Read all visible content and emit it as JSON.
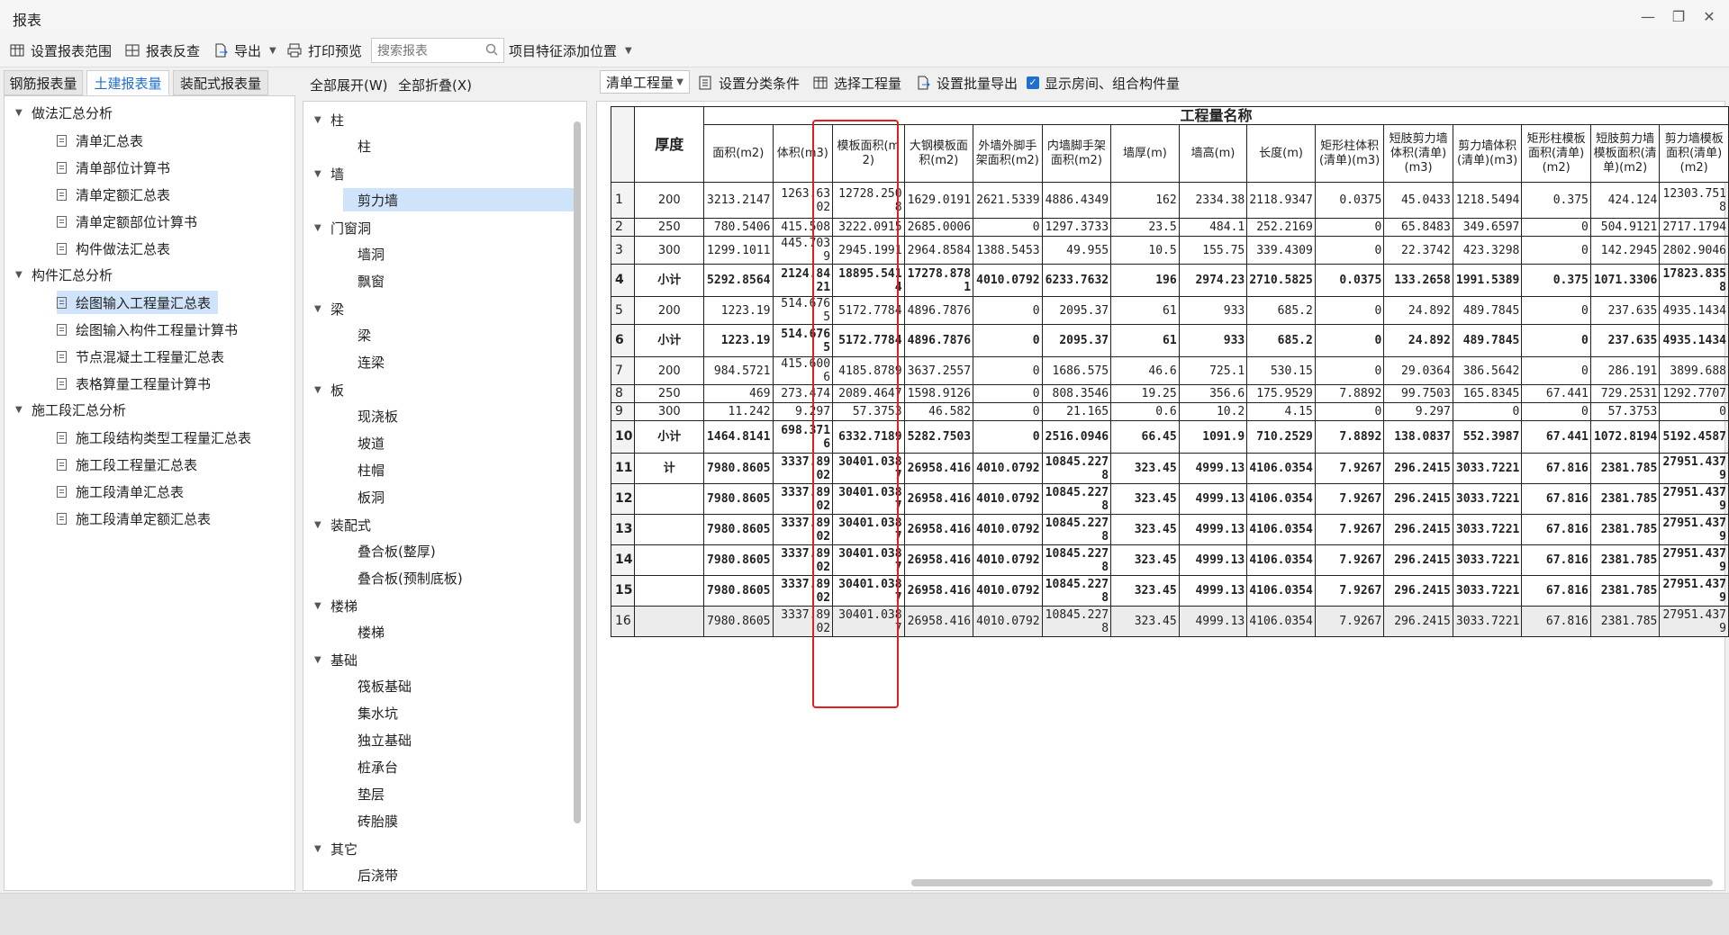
{
  "window": {
    "title": "报表"
  },
  "toolbar": {
    "set_range": "设置报表范围",
    "reverse_check": "报表反查",
    "export": "导出",
    "print_preview": "打印预览",
    "search_placeholder": "搜索报表",
    "add_feature_position": "项目特征添加位置"
  },
  "left_tabs": [
    {
      "label": "钢筋报表量",
      "active": false
    },
    {
      "label": "土建报表量",
      "active": true
    },
    {
      "label": "装配式报表量",
      "active": false
    }
  ],
  "left_tree": {
    "groups": [
      {
        "label": "做法汇总分析",
        "items": [
          "清单汇总表",
          "清单部位计算书",
          "清单定额汇总表",
          "清单定额部位计算书",
          "构件做法汇总表"
        ]
      },
      {
        "label": "构件汇总分析",
        "items": [
          "绘图输入工程量汇总表",
          "绘图输入构件工程量计算书",
          "节点混凝土工程量汇总表",
          "表格算量工程量计算书"
        ]
      },
      {
        "label": "施工段汇总分析",
        "items": [
          "施工段结构类型工程量汇总表",
          "施工段工程量汇总表",
          "施工段清单汇总表",
          "施工段清单定额汇总表"
        ]
      }
    ],
    "selected": "绘图输入工程量汇总表"
  },
  "middle": {
    "expand_all": "全部展开(W)",
    "collapse_all": "全部折叠(X)",
    "groups": [
      {
        "label": "柱",
        "items": [
          "柱"
        ]
      },
      {
        "label": "墙",
        "items": [
          "剪力墙"
        ]
      },
      {
        "label": "门窗洞",
        "items": [
          "墙洞",
          "飘窗"
        ]
      },
      {
        "label": "梁",
        "items": [
          "梁",
          "连梁"
        ]
      },
      {
        "label": "板",
        "items": [
          "现浇板",
          "坡道",
          "柱帽",
          "板洞"
        ]
      },
      {
        "label": "装配式",
        "items": [
          "叠合板(整厚)",
          "叠合板(预制底板)"
        ]
      },
      {
        "label": "楼梯",
        "items": [
          "楼梯"
        ]
      },
      {
        "label": "基础",
        "items": [
          "筏板基础",
          "集水坑",
          "独立基础",
          "桩承台",
          "垫层",
          "砖胎膜"
        ]
      },
      {
        "label": "其它",
        "items": [
          "后浇带"
        ]
      }
    ],
    "selected": "剪力墙"
  },
  "right_toolbar": {
    "quantity_select": "清单工程量",
    "set_category": "设置分类条件",
    "select_quantity": "选择工程量",
    "set_batch_export": "设置批量导出",
    "show_rooms": "显示房间、组合构件量",
    "show_rooms_checked": true
  },
  "report": {
    "group_header": "工程量名称",
    "thickness_header": "厚度",
    "columns": [
      "面积(m2)",
      "体积(m3)",
      "模板面积(m2)",
      "大钢模板面积(m2)",
      "外墙外脚手架面积(m2)",
      "内墙脚手架面积(m2)",
      "墙厚(m)",
      "墙高(m)",
      "长度(m)",
      "矩形柱体积(清单)(m3)",
      "短肢剪力墙体积(清单)(m3)",
      "剪力墙体积(清单)(m3)",
      "矩形柱模板面积(清单)(m2)",
      "短肢剪力墙模板面积(清单)(m2)",
      "剪力墙模板面积(清单)(m2)"
    ],
    "rows": [
      {
        "n": "1",
        "label": "200",
        "bold": false,
        "v": [
          "3213.2147",
          "1263.6302",
          "12728.2508",
          "1629.0191",
          "2621.5339",
          "4886.4349",
          "162",
          "2334.38",
          "2118.9347",
          "0.0375",
          "45.0433",
          "1218.5494",
          "0.375",
          "424.124",
          "12303.7518"
        ]
      },
      {
        "n": "2",
        "label": "250",
        "bold": false,
        "v": [
          "780.5406",
          "415.508",
          "3222.0915",
          "2685.0006",
          "0",
          "1297.3733",
          "23.5",
          "484.1",
          "252.2169",
          "0",
          "65.8483",
          "349.6597",
          "0",
          "504.9121",
          "2717.1794"
        ]
      },
      {
        "n": "3",
        "label": "300",
        "bold": false,
        "v": [
          "1299.1011",
          "445.7039",
          "2945.1991",
          "2964.8584",
          "1388.5453",
          "49.955",
          "10.5",
          "155.75",
          "339.4309",
          "0",
          "22.3742",
          "423.3298",
          "0",
          "142.2945",
          "2802.9046"
        ]
      },
      {
        "n": "4",
        "label": "小计",
        "bold": true,
        "v": [
          "5292.8564",
          "2124.8421",
          "18895.5414",
          "17278.8781",
          "4010.0792",
          "6233.7632",
          "196",
          "2974.23",
          "2710.5825",
          "0.0375",
          "133.2658",
          "1991.5389",
          "0.375",
          "1071.3306",
          "17823.8358"
        ]
      },
      {
        "n": "5",
        "label": "200",
        "bold": false,
        "v": [
          "1223.19",
          "514.6765",
          "5172.7784",
          "4896.7876",
          "0",
          "2095.37",
          "61",
          "933",
          "685.2",
          "0",
          "24.892",
          "489.7845",
          "0",
          "237.635",
          "4935.1434"
        ]
      },
      {
        "n": "6",
        "label": "小计",
        "bold": true,
        "v": [
          "1223.19",
          "514.6765",
          "5172.7784",
          "4896.7876",
          "0",
          "2095.37",
          "61",
          "933",
          "685.2",
          "0",
          "24.892",
          "489.7845",
          "0",
          "237.635",
          "4935.1434"
        ]
      },
      {
        "n": "7",
        "label": "200",
        "bold": false,
        "v": [
          "984.5721",
          "415.6006",
          "4185.8789",
          "3637.2557",
          "0",
          "1686.575",
          "46.6",
          "725.1",
          "530.15",
          "0",
          "29.0364",
          "386.5642",
          "0",
          "286.191",
          "3899.688"
        ]
      },
      {
        "n": "8",
        "label": "250",
        "bold": false,
        "v": [
          "469",
          "273.474",
          "2089.4647",
          "1598.9126",
          "0",
          "808.3546",
          "19.25",
          "356.6",
          "175.9529",
          "7.8892",
          "99.7503",
          "165.8345",
          "67.441",
          "729.2531",
          "1292.7707"
        ]
      },
      {
        "n": "9",
        "label": "300",
        "bold": false,
        "v": [
          "11.242",
          "9.297",
          "57.3753",
          "46.582",
          "0",
          "21.165",
          "0.6",
          "10.2",
          "4.15",
          "0",
          "9.297",
          "0",
          "0",
          "57.3753",
          "0"
        ]
      },
      {
        "n": "10",
        "label": "小计",
        "bold": true,
        "v": [
          "1464.8141",
          "698.3716",
          "6332.7189",
          "5282.7503",
          "0",
          "2516.0946",
          "66.45",
          "1091.9",
          "710.2529",
          "7.8892",
          "138.0837",
          "552.3987",
          "67.441",
          "1072.8194",
          "5192.4587"
        ]
      },
      {
        "n": "11",
        "label": "计",
        "bold": true,
        "v": [
          "7980.8605",
          "3337.8902",
          "30401.0387",
          "26958.416",
          "4010.0792",
          "10845.2278",
          "323.45",
          "4999.13",
          "4106.0354",
          "7.9267",
          "296.2415",
          "3033.7221",
          "67.816",
          "2381.785",
          "27951.4379"
        ]
      },
      {
        "n": "12",
        "label": "",
        "bold": true,
        "v": [
          "7980.8605",
          "3337.8902",
          "30401.0387",
          "26958.416",
          "4010.0792",
          "10845.2278",
          "323.45",
          "4999.13",
          "4106.0354",
          "7.9267",
          "296.2415",
          "3033.7221",
          "67.816",
          "2381.785",
          "27951.4379"
        ]
      },
      {
        "n": "13",
        "label": "",
        "bold": true,
        "v": [
          "7980.8605",
          "3337.8902",
          "30401.0387",
          "26958.416",
          "4010.0792",
          "10845.2278",
          "323.45",
          "4999.13",
          "4106.0354",
          "7.9267",
          "296.2415",
          "3033.7221",
          "67.816",
          "2381.785",
          "27951.4379"
        ]
      },
      {
        "n": "14",
        "label": "",
        "bold": true,
        "v": [
          "7980.8605",
          "3337.8902",
          "30401.0387",
          "26958.416",
          "4010.0792",
          "10845.2278",
          "323.45",
          "4999.13",
          "4106.0354",
          "7.9267",
          "296.2415",
          "3033.7221",
          "67.816",
          "2381.785",
          "27951.4379"
        ]
      },
      {
        "n": "15",
        "label": "",
        "bold": true,
        "v": [
          "7980.8605",
          "3337.8902",
          "30401.0387",
          "26958.416",
          "4010.0792",
          "10845.2278",
          "323.45",
          "4999.13",
          "4106.0354",
          "7.9267",
          "296.2415",
          "3033.7221",
          "67.816",
          "2381.785",
          "27951.4379"
        ]
      },
      {
        "n": "16",
        "label": "",
        "bold": false,
        "total": true,
        "v": [
          "7980.8605",
          "3337.8902",
          "30401.0387",
          "26958.416",
          "4010.0792",
          "10845.2278",
          "323.45",
          "4999.13",
          "4106.0354",
          "7.9267",
          "296.2415",
          "3033.7221",
          "67.816",
          "2381.785",
          "27951.4379"
        ]
      }
    ]
  },
  "colors": {
    "accent": "#1f6fd1",
    "selection": "#cfe3fb",
    "highlight_box": "#e02020"
  }
}
